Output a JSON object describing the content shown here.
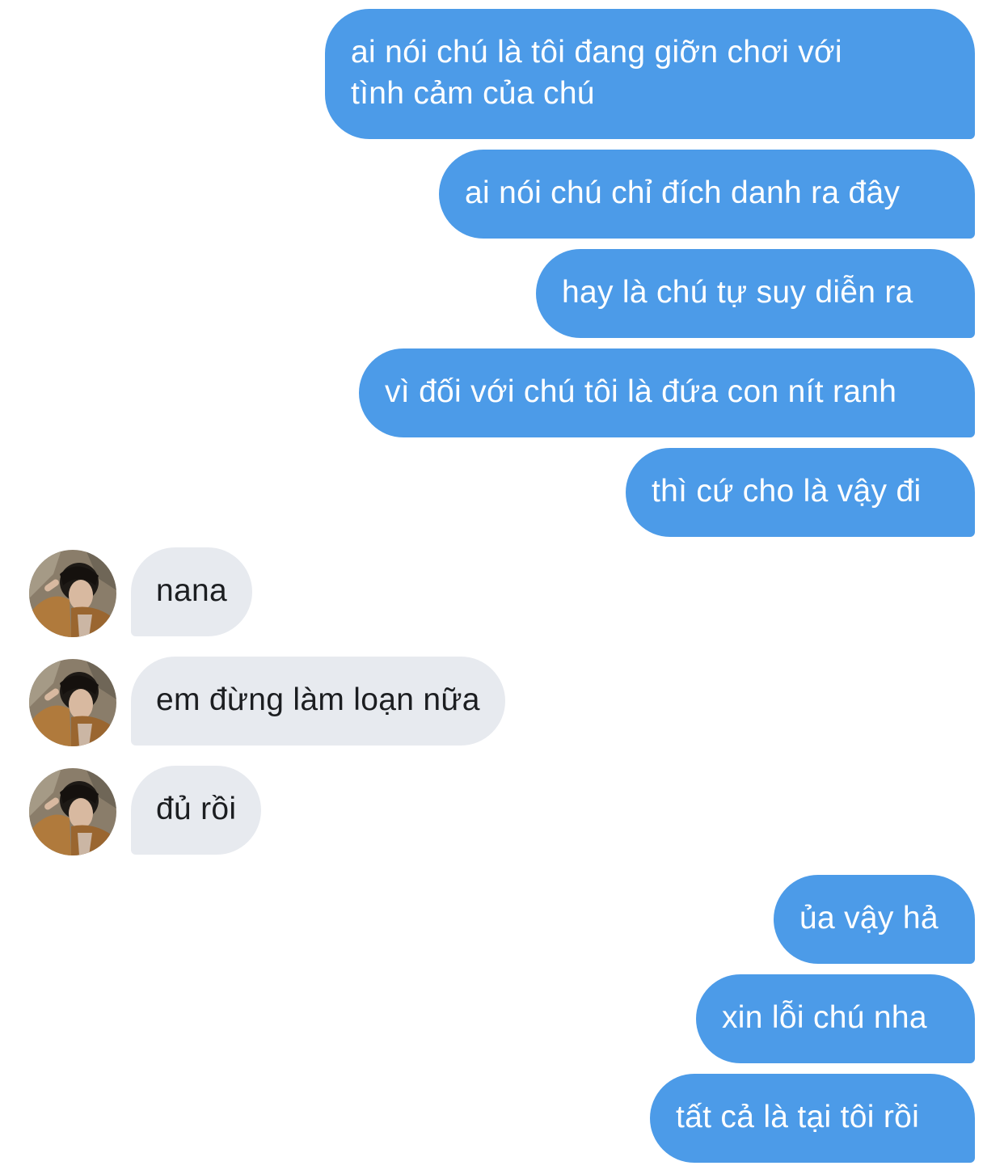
{
  "conversation": {
    "sent_1": "ai nói chú là tôi đang giỡn chơi với\ntình cảm của chú",
    "sent_2": "ai nói chú chỉ đích danh ra đây",
    "sent_3": "hay là chú tự suy diễn ra",
    "sent_4": "vì đối với chú tôi là đứa con nít ranh",
    "sent_5": "thì cứ cho là vậy đi",
    "recv_1": "nana",
    "recv_2": "em đừng làm loạn nữa",
    "recv_3": "đủ rồi",
    "sent_6": "ủa vậy hả",
    "sent_7": "xin lỗi chú nha",
    "sent_8": "tất cả là tại tôi rồi"
  },
  "colors": {
    "sent_bubble": "#4c9be8",
    "received_bubble": "#e7eaef",
    "sent_text": "#ffffff",
    "received_text": "#1c1e21"
  },
  "icons": {
    "avatar": "contact-avatar-photo"
  }
}
